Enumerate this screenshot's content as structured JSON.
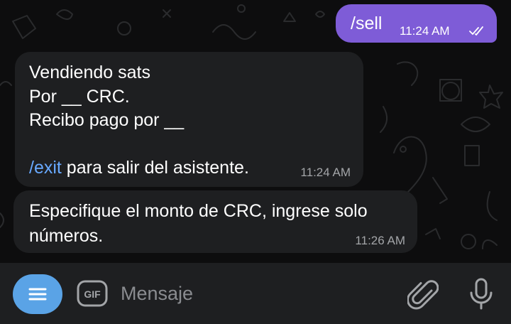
{
  "messages": [
    {
      "direction": "outgoing",
      "text": "/sell",
      "time": "11:24 AM",
      "status": "read-double-check-icon"
    },
    {
      "direction": "incoming",
      "line1": "Vendiendo sats",
      "line2": "Por __ CRC.",
      "line3": "Recibo pago por __",
      "command": "/exit",
      "command_suffix": " para salir del asistente.",
      "time": "11:24 AM"
    },
    {
      "direction": "incoming",
      "line1": "Especifique el monto de CRC, ingrese solo",
      "line2": "números.",
      "time": "11:26 AM"
    }
  ],
  "composer": {
    "placeholder": "Mensaje",
    "gif_label": "GIF",
    "icons": [
      "menu-icon",
      "gif-icon",
      "paperclip-icon",
      "microphone-icon"
    ]
  },
  "colors": {
    "outgoing_bubble": "#7e5cd7",
    "incoming_bubble": "#1e1f21",
    "link": "#68a9ff",
    "menu_button": "#5aa3e6",
    "background": "#0d0d0e"
  }
}
